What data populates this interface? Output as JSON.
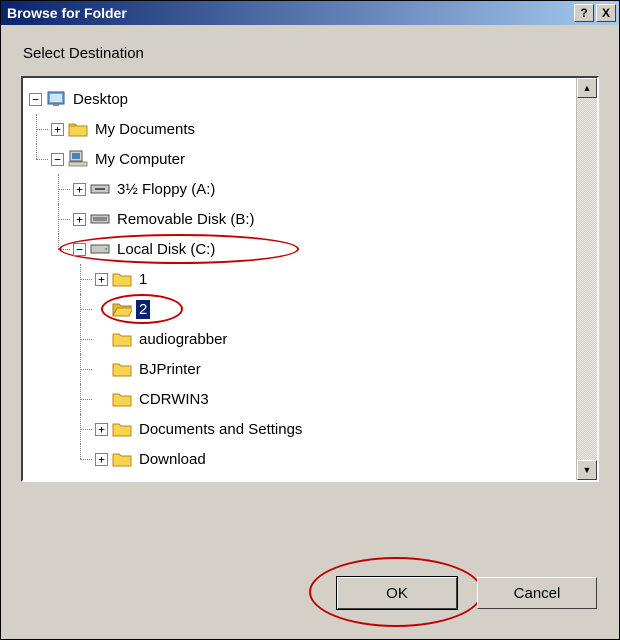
{
  "title": "Browse for Folder",
  "prompt": "Select Destination",
  "buttons": {
    "ok": "OK",
    "cancel": "Cancel"
  },
  "titlebar": {
    "help": "?",
    "close": "X"
  },
  "tree": {
    "desktop": "Desktop",
    "my_documents": "My Documents",
    "my_computer": "My Computer",
    "floppy": "3½ Floppy (A:)",
    "removable": "Removable Disk (B:)",
    "local_disk": "Local Disk (C:)",
    "folders": {
      "f1": "1",
      "f2": "2",
      "audiograbber": "audiograbber",
      "bjprinter": "BJPrinter",
      "cdrwin3": "CDRWIN3",
      "docs_settings": "Documents and Settings",
      "download": "Download"
    }
  },
  "selected": "2",
  "annotations": [
    "local_disk_c",
    "folder_2",
    "ok_button"
  ]
}
